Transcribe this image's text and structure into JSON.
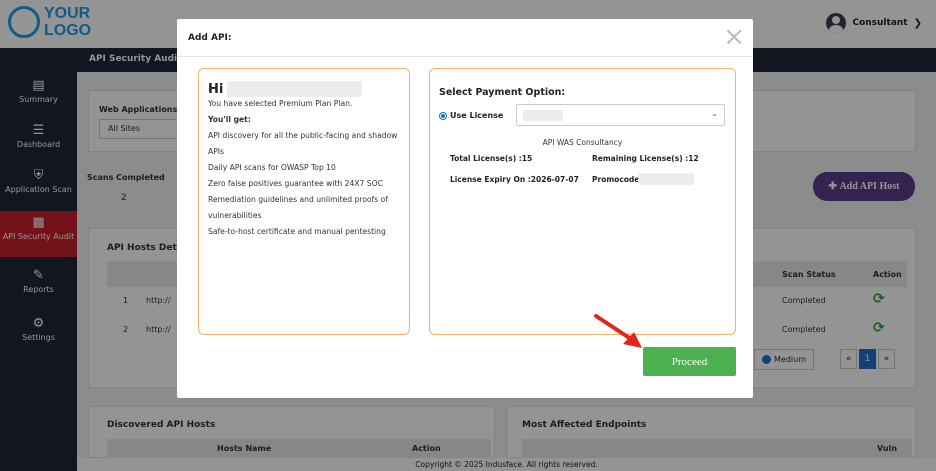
{
  "header": {
    "logo_line1": "YOUR",
    "logo_line2": "LOGO",
    "user_name": "Consultant"
  },
  "sidebar": {
    "items": [
      {
        "label": "Summary",
        "icon": "chart-icon"
      },
      {
        "label": "Dashboard",
        "icon": "dashboard-icon"
      },
      {
        "label": "Application Scan",
        "icon": "shield-icon"
      },
      {
        "label": "API Security Audit",
        "icon": "api-icon",
        "active": true
      },
      {
        "label": "Reports",
        "icon": "edit-icon"
      },
      {
        "label": "Settings",
        "icon": "gear-icon"
      }
    ]
  },
  "page": {
    "section_title": "API Security Audit",
    "web_apps_label": "Web Applications",
    "web_apps_value": "All Sites",
    "scans_completed_label": "Scans Completed",
    "scans_completed_value": "2",
    "add_host_button": "Add API Host",
    "hosts_details_title": "API Hosts Detai",
    "col_scan_status": "Scan Status",
    "col_action": "Action",
    "rows": [
      {
        "num": "1",
        "url": "http://",
        "status": "Completed"
      },
      {
        "num": "2",
        "url": "http://",
        "status": "Completed"
      }
    ],
    "legend_medium": "Medium",
    "pager_prev": "«",
    "pager_current": "1",
    "pager_next": "»",
    "discovered_title": "Discovered API Hosts",
    "col_hosts_name": "Hosts Name",
    "col_action2": "Action",
    "affected_title": "Most Affected Endpoints",
    "col_vuln": "Vuln"
  },
  "footer": "Copyright © 2025 Indusface. All rights reserved.",
  "modal": {
    "title": "Add API:",
    "close_label": "×",
    "greeting": "Hi",
    "plan_lines": [
      "You have selected Premium Plan Plan.",
      "You'll get:",
      "API discovery for all the public-facing and shadow",
      "APIs",
      "Daily API scans for OWASP Top 10",
      "Zero false positives guarantee with 24X7 SOC",
      "Remediation guidelines and unlimited proofs of",
      "vulnerabilities",
      "Safe-to-host certificate and manual pentesting"
    ],
    "payment_title": "Select Payment Option:",
    "use_license_label": "Use License",
    "consultancy_name": "API WAS Consultancy",
    "total_licenses": "Total License(s) :15",
    "remaining_licenses": "Remaining License(s) :12",
    "license_expiry": "License Expiry On :2026-07-07",
    "promocode_label": "Promocode",
    "proceed_label": "Proceed"
  },
  "colors": {
    "sidebar_bg": "#1f2637",
    "active_item": "#c91f2d",
    "logo": "#1aa0e8",
    "panel_border": "#f0b46a",
    "proceed": "#4caf50",
    "add_host": "#5a3c8c",
    "arrow": "#e0241b"
  }
}
